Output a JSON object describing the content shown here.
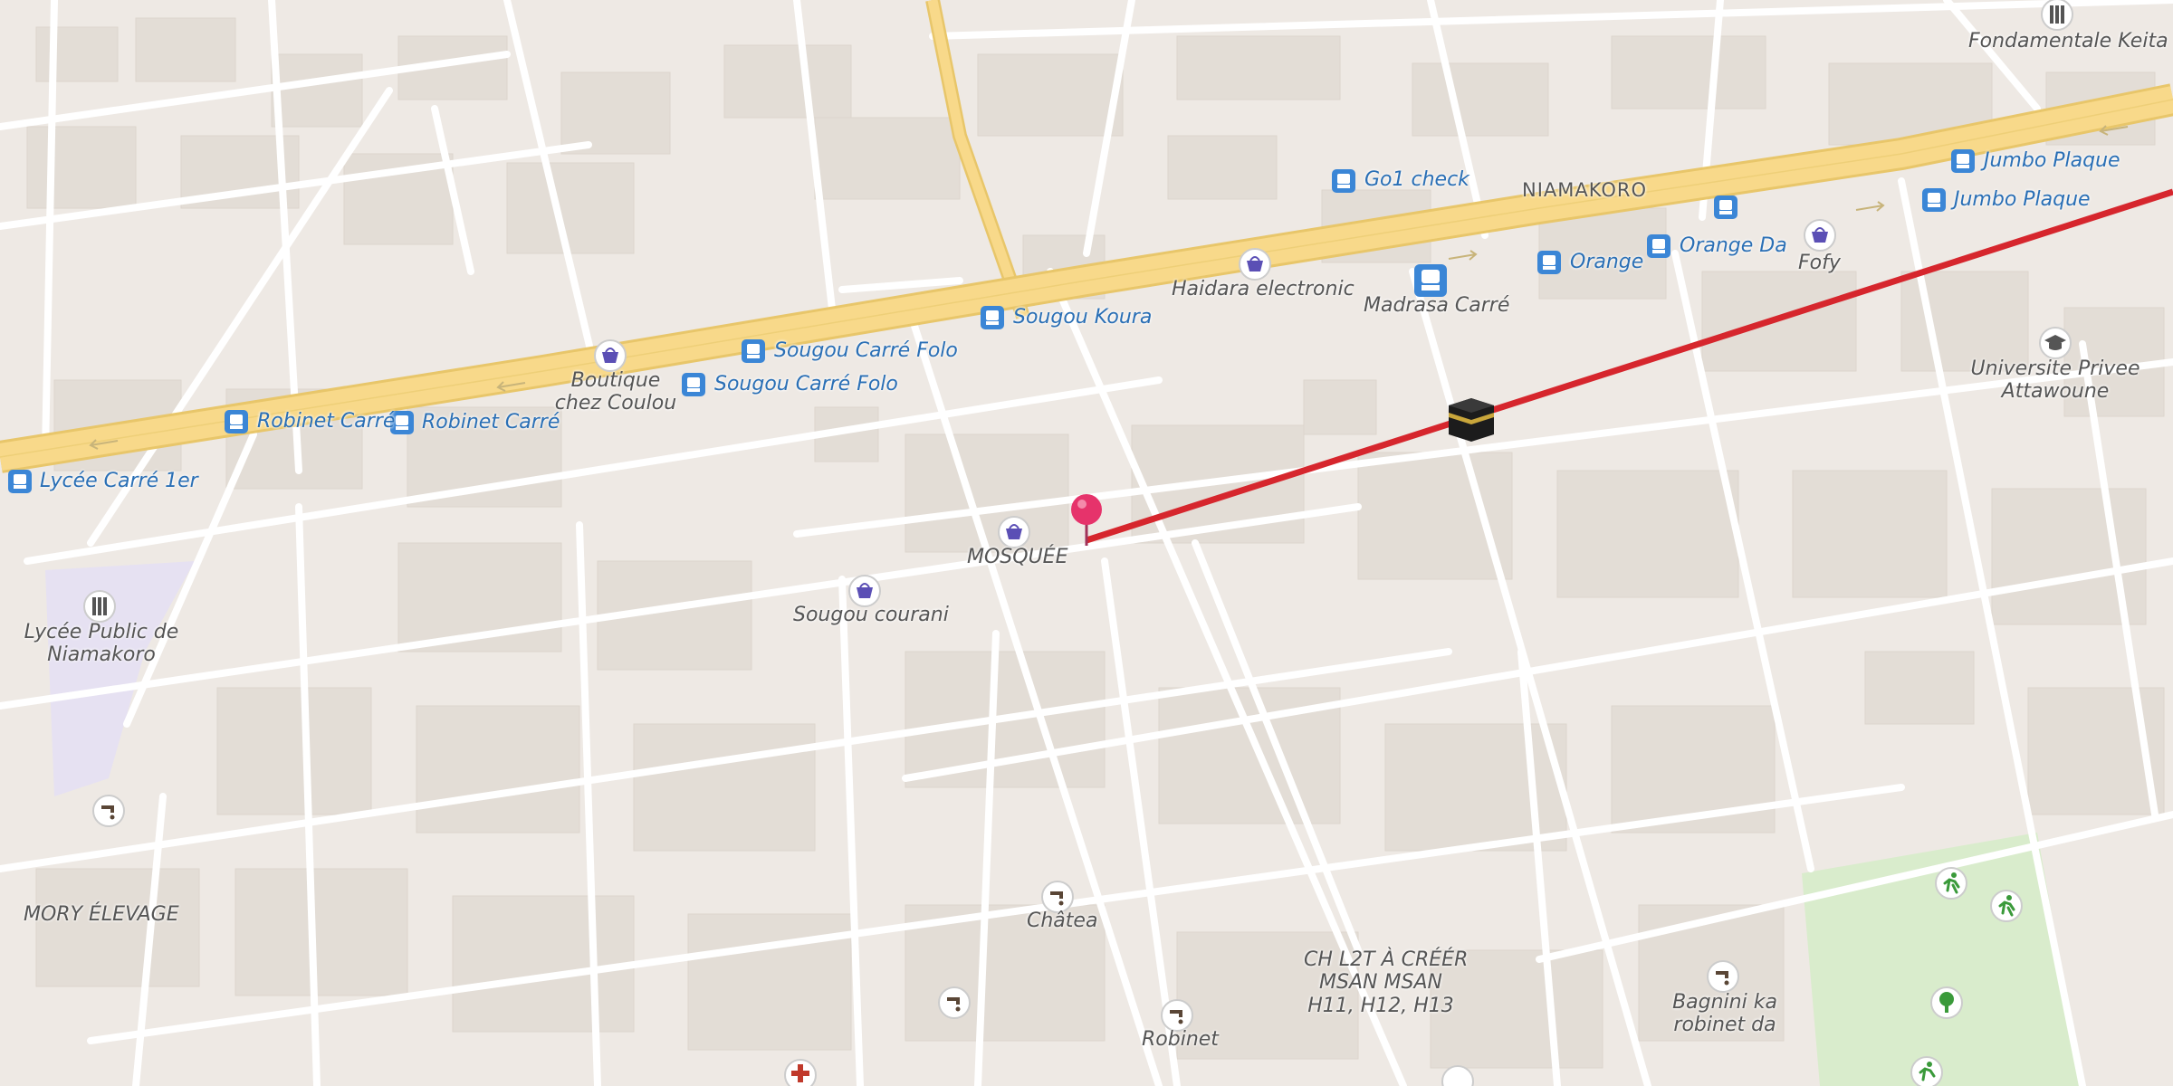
{
  "map": {
    "area_labels": {
      "niamakoro": "NIAMAKORO",
      "mory_elevage": "MORY ÉLEVAGE",
      "ch_l2t_1": "CH L2T À CRÉÉR",
      "ch_l2t_2": "MSAN MSAN",
      "ch_l2t_3": "H11, H12, H13"
    },
    "transit_stops": {
      "go1_check": "Go1 check",
      "sougou_koura": "Sougou Koura",
      "sougou_carre_folo_1": "Sougou Carré Folo",
      "sougou_carre_folo_2": "Sougou Carré Folo",
      "robinet_carre_1": "Robinet Carré",
      "robinet_carre_2": "Robinet Carré",
      "lycee_carre_1er": "Lycée Carré 1er",
      "orange": "Orange",
      "orange_da": "Orange Da",
      "jumbo_plaque_1": "Jumbo Plaque",
      "jumbo_plaque_2": "Jumbo Plaque",
      "madrasa_carre": "Madrasa Carré"
    },
    "pois": {
      "fondamentale_keita": "Fondamentale Keita",
      "haidara_electronic": "Haidara electronic",
      "fofy": "Fofy",
      "boutique_1": "Boutique",
      "boutique_2": "chez Coulou",
      "universite_1": "Universite Privee",
      "universite_2": "Attawoune",
      "mosquee": "MOSQUÉE",
      "sougou_courani": "Sougou courani",
      "lycee_public_1": "Lycée Public de",
      "lycee_public_2": "Niamakoro",
      "chatea": "Châtea",
      "robinet": "Robinet",
      "bagnini_1": "Bagnini ka",
      "bagnini_2": "robinet da"
    },
    "icons": {
      "shop": "shopping-basket-icon",
      "bus": "bus-stop-icon",
      "school": "school-icon",
      "university": "graduation-cap-icon",
      "water": "water-tap-icon",
      "kaaba": "kaaba-icon",
      "pin": "location-pin-icon",
      "hospital": "hospital-cross-icon",
      "sport": "sports-icon",
      "tree": "tree-icon"
    },
    "colors": {
      "land": "#eee9e4",
      "road": "#ffffff",
      "main_road": "#f8d98a",
      "route": "#d6262d",
      "pin": "#e6336b",
      "transit_text": "#2a6fb5",
      "poi_text": "#555555",
      "park": "#d9eccc",
      "school_area": "#e6e1f2"
    }
  }
}
